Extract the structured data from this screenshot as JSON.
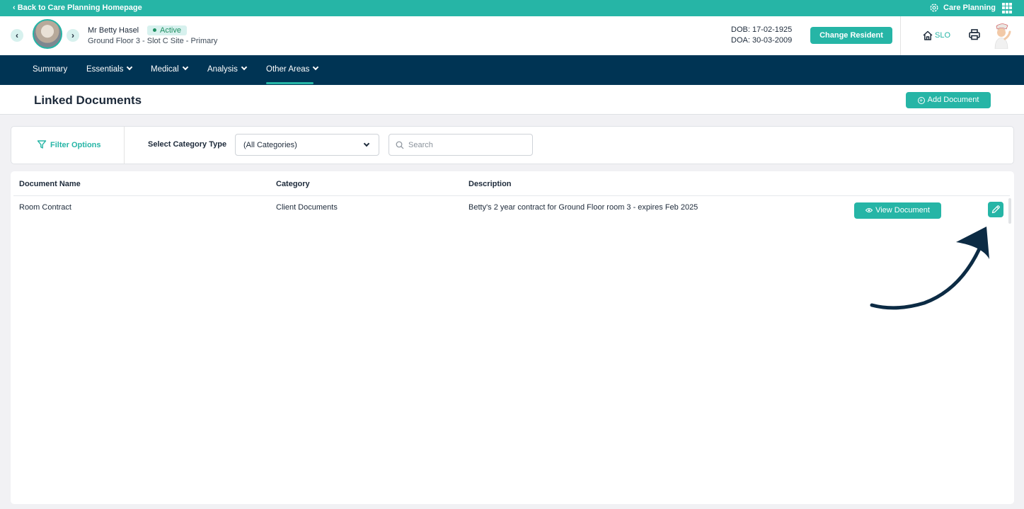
{
  "topbar": {
    "back_label": "‹ Back to Care Planning Homepage",
    "app_name": "Care Planning"
  },
  "resident": {
    "name": "Mr Betty Hasel",
    "status": "Active",
    "location": "Ground Floor 3 - Slot C Site - Primary",
    "dob": "DOB: 17-02-1925",
    "doa": "DOA: 30-03-2009",
    "change_label": "Change Resident",
    "home_label": "SLO"
  },
  "nav": {
    "items": [
      {
        "label": "Summary"
      },
      {
        "label": "Essentials"
      },
      {
        "label": "Medical"
      },
      {
        "label": "Analysis"
      },
      {
        "label": "Other Areas"
      }
    ],
    "active": "Other Areas"
  },
  "page": {
    "title": "Linked Documents",
    "add_label": "Add Document"
  },
  "filter": {
    "options_label": "Filter Options",
    "category_label": "Select Category Type",
    "category_value": "(All Categories)",
    "search_placeholder": "Search"
  },
  "table": {
    "columns": [
      "Document Name",
      "Category",
      "Description"
    ],
    "rows": [
      {
        "name": "Room Contract",
        "category": "Client Documents",
        "description": "Betty's 2 year contract for Ground Floor room 3 - expires Feb 2025",
        "view_label": "View Document"
      }
    ]
  },
  "colors": {
    "teal": "#26b5a6",
    "navy": "#003454",
    "arrow": "#0c2b44"
  }
}
